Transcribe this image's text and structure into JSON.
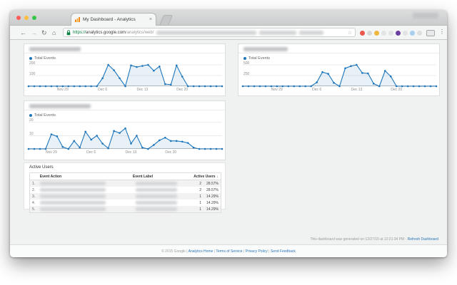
{
  "browser": {
    "tab": {
      "title": "My Dashboard - Analytics",
      "close_icon": "×"
    },
    "toolbar": {
      "back_icon": "←",
      "forward_icon": "→",
      "reload_icon": "↻",
      "home_icon": "⌂",
      "url_scheme": "https://",
      "url_host": "analytics.google.com",
      "url_path": "/analytics/web/",
      "bookmark_star_icon": "☆",
      "menu_icon": "⋮"
    }
  },
  "dashboard": {
    "generated_note": "This dashboard was generated on 12/27/15 at 12:21:34 PM -",
    "refresh_link": "Refresh Dashboard",
    "footer_copyright": "© 2015 Google |",
    "footer_links": [
      "Analytics Home",
      "Terms of Service",
      "Privacy Policy",
      "Send Feedback"
    ]
  },
  "colors": {
    "accent_blue": "#1d76bb",
    "area_fill": "rgba(29,118,187,0.10)",
    "grid": "#e4e4e4",
    "baseline": "#a9a9a9",
    "link_blue": "#2d76b5",
    "secure_green": "#0b8043",
    "favicon_orange": "#f57c00"
  },
  "chart_data": [
    {
      "type": "line",
      "title_redacted": true,
      "legend": "Total Events",
      "ylabel": "Total Events",
      "ylim": [
        0,
        220
      ],
      "yticks": [
        200,
        100
      ],
      "x_labels": [
        {
          "text": "Nov 29",
          "i": 6
        },
        {
          "text": "Dec 6",
          "i": 13
        },
        {
          "text": "Dec 13",
          "i": 20
        },
        {
          "text": "Dec 20",
          "i": 27
        }
      ],
      "values": [
        0,
        0,
        0,
        0,
        0,
        0,
        0,
        0,
        0,
        0,
        0,
        0,
        0,
        75,
        200,
        150,
        75,
        0,
        195,
        180,
        190,
        200,
        145,
        185,
        20,
        15,
        195,
        90,
        0,
        0,
        0,
        0,
        0,
        0,
        0
      ]
    },
    {
      "type": "line",
      "title_redacted": true,
      "legend": "Total Events",
      "ylabel": "Total Events",
      "ylim": [
        0,
        550
      ],
      "yticks": [
        500,
        250
      ],
      "x_labels": [
        {
          "text": "Nov 29",
          "i": 6
        },
        {
          "text": "Dec 6",
          "i": 13
        },
        {
          "text": "Dec 13",
          "i": 20
        },
        {
          "text": "Dec 20",
          "i": 27
        }
      ],
      "values": [
        0,
        0,
        0,
        0,
        0,
        0,
        0,
        0,
        0,
        0,
        0,
        0,
        0,
        90,
        330,
        290,
        80,
        0,
        420,
        470,
        500,
        310,
        300,
        60,
        0,
        360,
        230,
        0,
        0,
        0,
        0,
        0,
        0,
        0,
        0
      ]
    },
    {
      "type": "line",
      "title_redacted": true,
      "legend": "Total Events",
      "ylabel": "Total Events",
      "ylim": [
        0,
        22
      ],
      "yticks": [
        20,
        10
      ],
      "x_labels": [
        {
          "text": "Nov 29",
          "i": 4
        },
        {
          "text": "Dec 6",
          "i": 11
        },
        {
          "text": "Dec 13",
          "i": 18
        },
        {
          "text": "Dec 20",
          "i": 25
        }
      ],
      "values": [
        0,
        0,
        0,
        0,
        11,
        9.5,
        1.5,
        0,
        6,
        1,
        13,
        7,
        10,
        4,
        0.5,
        13.5,
        12,
        15.5,
        4,
        10,
        1,
        0,
        3,
        6.5,
        8.5,
        6,
        6,
        5.5,
        4.5,
        1,
        0,
        0,
        0,
        0,
        0
      ]
    },
    {
      "type": "table",
      "title": "Active Users",
      "columns": [
        "Event Action",
        "Event Label",
        "Active Users"
      ],
      "sort_icon": "↓",
      "rows": [
        {
          "rank": "1.",
          "action_redacted": true,
          "label_redacted": true,
          "users": "2",
          "percent": "28.57%"
        },
        {
          "rank": "2.",
          "action_redacted": true,
          "label_redacted": true,
          "users": "2",
          "percent": "28.57%"
        },
        {
          "rank": "3.",
          "action_redacted": true,
          "label_redacted": true,
          "users": "1",
          "percent": "14.29%"
        },
        {
          "rank": "4.",
          "action_redacted": true,
          "label_redacted": true,
          "users": "1",
          "percent": "14.29%"
        },
        {
          "rank": "5.",
          "action_redacted": true,
          "label_redacted": true,
          "users": "1",
          "percent": "14.29%"
        }
      ]
    }
  ]
}
